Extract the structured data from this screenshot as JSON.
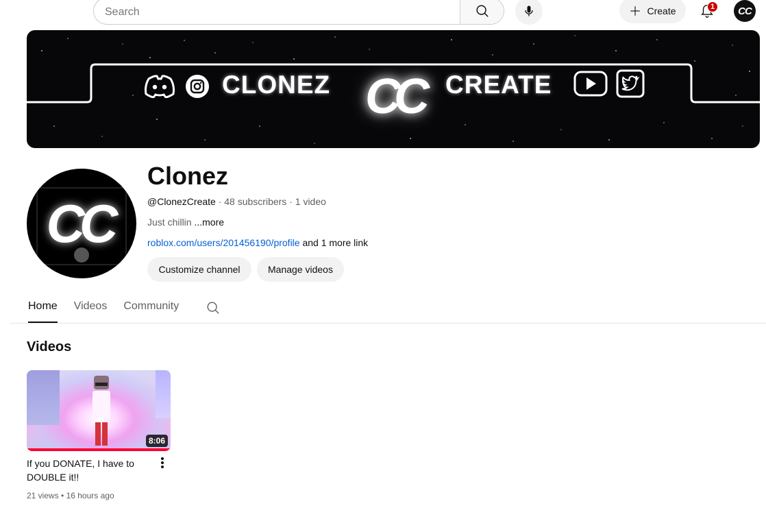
{
  "topbar": {
    "search_placeholder": "Search",
    "create_label": "Create",
    "notification_count": "1",
    "account_avatar_text": "CC"
  },
  "banner": {
    "left_text": "CLONEZ",
    "right_text": "CREATE",
    "logo_text": "CC",
    "icons": [
      "discord-icon",
      "instagram-icon",
      "youtube-play-icon",
      "twitter-icon"
    ]
  },
  "channel": {
    "avatar_text": "CC",
    "name": "Clonez",
    "handle": "@ClonezCreate",
    "meta_sep1": " · ",
    "subscribers": "48 subscribers",
    "meta_sep2": " · ",
    "video_count": "1 video",
    "description": "Just chillin ",
    "description_more": "...more",
    "link": "roblox.com/users/201456190/profile",
    "more_links": " and 1 more link",
    "customize_label": "Customize channel",
    "manage_label": "Manage videos"
  },
  "tabs": [
    {
      "label": "Home",
      "active": true
    },
    {
      "label": "Videos",
      "active": false
    },
    {
      "label": "Community",
      "active": false
    }
  ],
  "videos_section": {
    "title": "Videos",
    "items": [
      {
        "title": "If you DONATE, I have to DOUBLE it!!",
        "duration": "8:06",
        "views": "21 views",
        "sep": " • ",
        "age": "16 hours ago",
        "watched_progress": 1.0
      }
    ]
  },
  "colors": {
    "accent_link": "#065fd4",
    "badge_red": "#cc0000",
    "progress_red": "#ff0033",
    "text_primary": "#0f0f0f",
    "text_secondary": "#606060"
  }
}
